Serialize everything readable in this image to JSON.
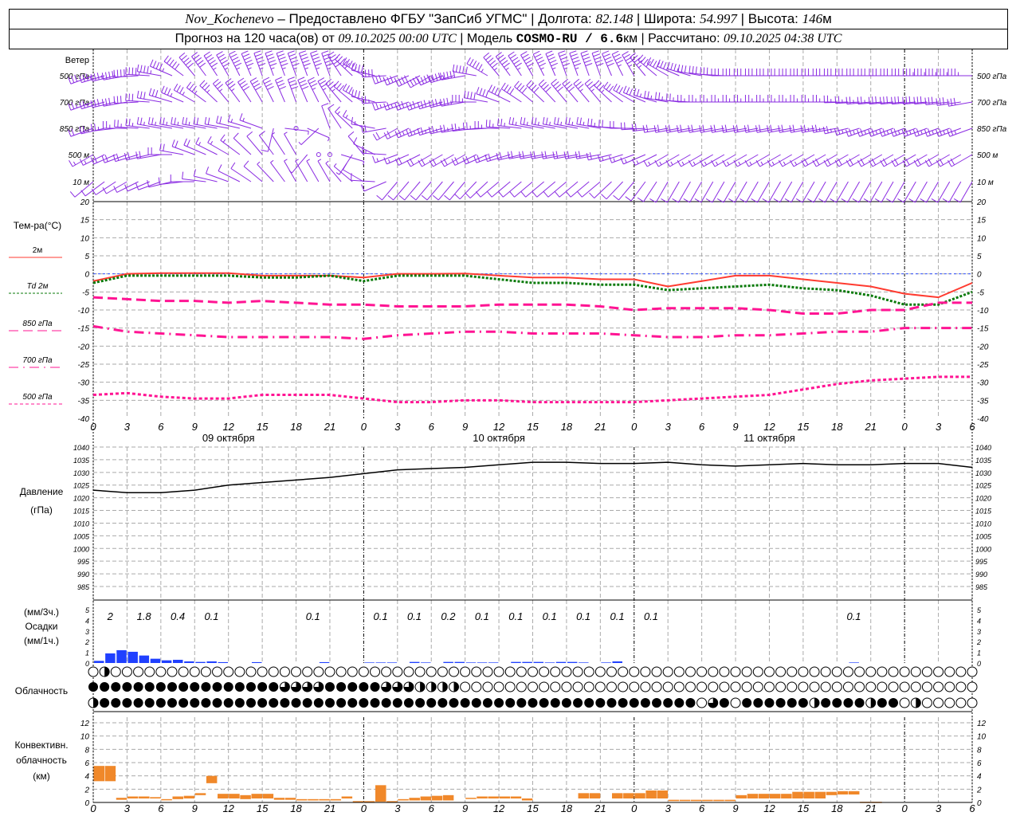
{
  "header": {
    "station": "Nov_Kochenevo",
    "provider": " – Предоставлено ФГБУ \"ЗапСиб УГМС\" | Долгота: ",
    "lon": "82.148",
    "lat_label": " | Широта: ",
    "lat": "54.997",
    "alt_label": " | Высота: ",
    "alt": "146",
    "alt_unit": "м",
    "forecast_label": "Прогноз на 120 часа(ов) от ",
    "forecast_time": "09.10.2025 00:00 UTC",
    "model_label": "  | Модель ",
    "model": "COSMO-RU / 6.6",
    "model_unit": "км | Рассчитано: ",
    "calc_time": "09.10.2025 04:38 UTC"
  },
  "chart_data": {
    "type": "meteogram",
    "hours": [
      0,
      3,
      6,
      9,
      12,
      15,
      18,
      21,
      24,
      27,
      30,
      33,
      36,
      39,
      42,
      45,
      48,
      51,
      54,
      57,
      60,
      63,
      66,
      69,
      72,
      75,
      78
    ],
    "x_tick_labels": [
      "0",
      "3",
      "6",
      "9",
      "12",
      "15",
      "18",
      "21",
      "0",
      "3",
      "6",
      "9",
      "12",
      "15",
      "18",
      "21",
      "0",
      "3",
      "6",
      "9",
      "12",
      "15",
      "18",
      "21",
      "0",
      "3",
      "6"
    ],
    "dates": [
      "09 октября",
      "10 октября",
      "11 октября"
    ],
    "wind": {
      "title": "Ветер",
      "levels": [
        "500 гПа",
        "700 гПа",
        "850 гПа",
        "500 м",
        "10  м"
      ],
      "dir": [
        [
          250,
          260,
          280,
          320,
          330,
          340,
          340,
          340,
          300,
          250,
          240,
          260,
          320,
          330,
          340,
          340,
          330,
          300,
          280,
          270,
          270,
          270,
          270,
          270,
          270,
          270,
          270
        ],
        [
          250,
          260,
          280,
          300,
          320,
          330,
          340,
          330,
          300,
          250,
          250,
          260,
          290,
          310,
          320,
          320,
          300,
          280,
          270,
          270,
          270,
          270,
          270,
          265,
          265,
          265,
          260
        ],
        [
          250,
          270,
          280,
          280,
          280,
          290,
          0,
          340,
          300,
          240,
          250,
          260,
          270,
          280,
          280,
          280,
          270,
          260,
          260,
          260,
          260,
          260,
          260,
          250,
          250,
          250,
          250
        ],
        [
          240,
          250,
          260,
          290,
          300,
          320,
          330,
          0,
          320,
          250,
          240,
          240,
          250,
          260,
          260,
          260,
          250,
          240,
          240,
          240,
          240,
          240,
          240,
          240,
          240,
          240,
          240
        ],
        [
          230,
          240,
          250,
          270,
          290,
          310,
          330,
          330,
          300,
          220,
          220,
          220,
          230,
          230,
          230,
          230,
          220,
          210,
          210,
          210,
          210,
          210,
          210,
          210,
          210,
          210,
          210
        ]
      ],
      "speed": [
        [
          30,
          40,
          45,
          50,
          55,
          55,
          55,
          55,
          45,
          35,
          40,
          50,
          55,
          55,
          55,
          50,
          45,
          40,
          30,
          30,
          30,
          30,
          30,
          30,
          30,
          35,
          35
        ],
        [
          25,
          30,
          30,
          35,
          35,
          40,
          40,
          35,
          30,
          25,
          30,
          35,
          40,
          40,
          40,
          35,
          30,
          25,
          25,
          25,
          25,
          25,
          25,
          25,
          30,
          30,
          30
        ],
        [
          20,
          25,
          25,
          25,
          20,
          15,
          0,
          10,
          15,
          20,
          25,
          25,
          25,
          25,
          25,
          25,
          20,
          20,
          20,
          20,
          20,
          20,
          25,
          25,
          25,
          25,
          25
        ],
        [
          15,
          20,
          20,
          20,
          15,
          10,
          5,
          0,
          10,
          15,
          20,
          20,
          20,
          20,
          20,
          20,
          15,
          15,
          15,
          15,
          15,
          15,
          20,
          20,
          20,
          20,
          20
        ],
        [
          10,
          10,
          10,
          10,
          10,
          8,
          5,
          5,
          8,
          10,
          10,
          10,
          10,
          10,
          10,
          10,
          10,
          10,
          10,
          10,
          10,
          10,
          10,
          10,
          10,
          10,
          10
        ]
      ]
    },
    "temperature": {
      "title": "Тем-ра(°С)",
      "ylim": [
        -40,
        20
      ],
      "yticks": [
        20,
        15,
        10,
        5,
        0,
        -5,
        -10,
        -15,
        -20,
        -25,
        -30,
        -35,
        -40
      ],
      "series": [
        {
          "name": "2м",
          "color": "#ff3b30",
          "values": [
            -2,
            0,
            0.2,
            0.2,
            0.2,
            -0.5,
            -0.5,
            -0.5,
            -1,
            0,
            0,
            0.1,
            -0.5,
            -1,
            -1,
            -1.5,
            -1.5,
            -3.5,
            -2,
            -0.5,
            -0.5,
            -1.5,
            -2.5,
            -3.5,
            -5.5,
            -6.5,
            -2.5
          ]
        },
        {
          "name": "Td  2м",
          "color": "#0a7a0a",
          "values": [
            -2.5,
            -0.5,
            -0.5,
            -0.5,
            -0.5,
            -1,
            -1,
            -0.5,
            -2,
            -0.5,
            -0.5,
            -0.5,
            -1.5,
            -2.5,
            -2.5,
            -3,
            -3,
            -4.5,
            -4,
            -3.5,
            -3,
            -4,
            -4.5,
            -6,
            -8.5,
            -8.5,
            -5
          ]
        },
        {
          "name": "850 гПа",
          "color": "#ff1493",
          "values": [
            -6.5,
            -7,
            -7.5,
            -7.5,
            -8,
            -7.5,
            -8,
            -8.5,
            -8.5,
            -9,
            -9,
            -9,
            -8.5,
            -8.5,
            -8.5,
            -9,
            -10,
            -9.5,
            -9.5,
            -9.5,
            -10,
            -11,
            -11,
            -10,
            -10,
            -8,
            -8
          ]
        },
        {
          "name": "700 гПа",
          "color": "#ff1493",
          "values": [
            -14.5,
            -16,
            -16.5,
            -17,
            -17.5,
            -17.5,
            -17.5,
            -17.5,
            -18,
            -17,
            -16.5,
            -16,
            -16,
            -16.5,
            -16.5,
            -16.5,
            -17,
            -17.5,
            -17.5,
            -17,
            -17,
            -16.5,
            -16,
            -16,
            -15,
            -15,
            -15
          ]
        },
        {
          "name": "500 гПа",
          "color": "#ff1493",
          "values": [
            -33.5,
            -33,
            -34,
            -34.5,
            -34.5,
            -33.5,
            -33.5,
            -33.5,
            -34.5,
            -35.5,
            -35.5,
            -35,
            -35,
            -35.5,
            -35.5,
            -35.5,
            -35.5,
            -35,
            -34.5,
            -34,
            -33.5,
            -32,
            -30.5,
            -29.5,
            -29,
            -28.5,
            -28.5
          ]
        }
      ]
    },
    "pressure": {
      "title": "Давление",
      "unit": "(гПа)",
      "ylim": [
        985,
        1040
      ],
      "yticks": [
        1040,
        1035,
        1030,
        1025,
        1020,
        1015,
        1010,
        1005,
        1000,
        995,
        990,
        985
      ],
      "values": [
        1023,
        1022,
        1022,
        1023,
        1025,
        1026,
        1027,
        1028,
        1029.5,
        1031,
        1031.5,
        1032,
        1033,
        1034,
        1034,
        1033.5,
        1033.5,
        1034,
        1033,
        1032.5,
        1033,
        1033.5,
        1033,
        1033,
        1033.5,
        1033.5,
        1032
      ]
    },
    "precip": {
      "label3": "(мм/3ч.)",
      "title": "Осадки",
      "label1": "(мм/1ч.)",
      "ylim": [
        0,
        5.5
      ],
      "yticks": [
        5,
        4,
        3,
        2,
        1,
        0
      ],
      "color": "#2040ff",
      "hourly": [
        0.2,
        0.9,
        1.2,
        1.05,
        0.7,
        0.4,
        0.25,
        0.3,
        0.15,
        0.1,
        0.15,
        0.08,
        0,
        0,
        0.08,
        0,
        0,
        0,
        0,
        0,
        0.08,
        0,
        0,
        0,
        0.05,
        0.05,
        0.05,
        0,
        0.1,
        0.05,
        0,
        0.1,
        0.1,
        0.05,
        0.05,
        0.05,
        0,
        0.1,
        0.1,
        0.1,
        0.05,
        0.1,
        0.1,
        0.05,
        0,
        0.05,
        0.15,
        0,
        0,
        0,
        0,
        0,
        0,
        0,
        0,
        0,
        0,
        0,
        0,
        0,
        0,
        0,
        0,
        0,
        0,
        0,
        0,
        0.05,
        0,
        0,
        0,
        0,
        0,
        0,
        0,
        0,
        0,
        0
      ],
      "totals3h": [
        "2",
        "1.8",
        "0.4",
        "0.1",
        "",
        "",
        "0.1",
        "",
        "0.1",
        "0.1",
        "0.2",
        "0.1",
        "0.1",
        "0.1",
        "0.1",
        "0.1",
        "0.1",
        "",
        "",
        "",
        "",
        "",
        "0.1",
        "",
        "",
        ""
      ]
    },
    "cloud": {
      "title": "Облачность",
      "rows": [
        "0200000000000000000000000000000000000000000000000000000000000000000000000000000",
        "4444444444444444433334444433322220000000000000000000000000000000000000000000000",
        "2444444444444444444444444444444444444444444444444444440340444444244442440200000"
      ]
    },
    "convective": {
      "title1": "Конвективн.",
      "title2": "облачность",
      "unit": "(км)",
      "ylim": [
        0,
        13
      ],
      "yticks": [
        12,
        10,
        8,
        6,
        4,
        2,
        0
      ],
      "color": "#f0882a",
      "base": [
        3.2,
        3.2,
        0.4,
        0.6,
        0.6,
        0.6,
        0.4,
        0.5,
        0.6,
        1.1,
        2.9,
        0.6,
        0.6,
        0.5,
        0.6,
        0.6,
        0.4,
        0.4,
        0.3,
        0.3,
        0.3,
        0.3,
        0.6,
        0.1,
        0.1,
        0.1,
        0.1,
        0.3,
        0.3,
        0.3,
        0.3,
        0.3,
        0,
        0.6,
        0.6,
        0.6,
        0.6,
        0.6,
        0.3,
        0,
        0,
        0,
        0,
        0.6,
        0.6,
        0,
        0.6,
        0.6,
        0.6,
        0.6,
        0.6,
        0.2,
        0.2,
        0.2,
        0.2,
        0.2,
        0.2,
        0.6,
        0.6,
        0.6,
        0.6,
        0.6,
        0.6,
        0.6,
        0.6,
        1.1,
        1.2,
        1.2,
        0,
        0,
        0,
        0,
        0,
        0,
        0,
        0,
        0,
        0
      ],
      "top": [
        5.5,
        5.5,
        0.7,
        0.9,
        0.9,
        0.8,
        0.5,
        0.9,
        1,
        1.4,
        4,
        1.3,
        1.3,
        1.1,
        1.3,
        1.3,
        0.7,
        0.7,
        0.5,
        0.5,
        0.5,
        0.5,
        0.9,
        0.2,
        0.2,
        2.6,
        0.2,
        0.5,
        0.7,
        0.9,
        1,
        1.1,
        0,
        0.7,
        0.9,
        0.9,
        0.9,
        0.9,
        0.6,
        0,
        0,
        0,
        0,
        1.4,
        1.4,
        0,
        1.4,
        1.4,
        1.4,
        1.8,
        1.8,
        0.4,
        0.4,
        0.4,
        0.4,
        0.4,
        0.4,
        1.1,
        1.3,
        1.3,
        1.3,
        1.3,
        1.6,
        1.6,
        1.6,
        1.6,
        1.7,
        1.7,
        0.1,
        0.1,
        0,
        0,
        0,
        0,
        0,
        0,
        0,
        0
      ]
    }
  }
}
